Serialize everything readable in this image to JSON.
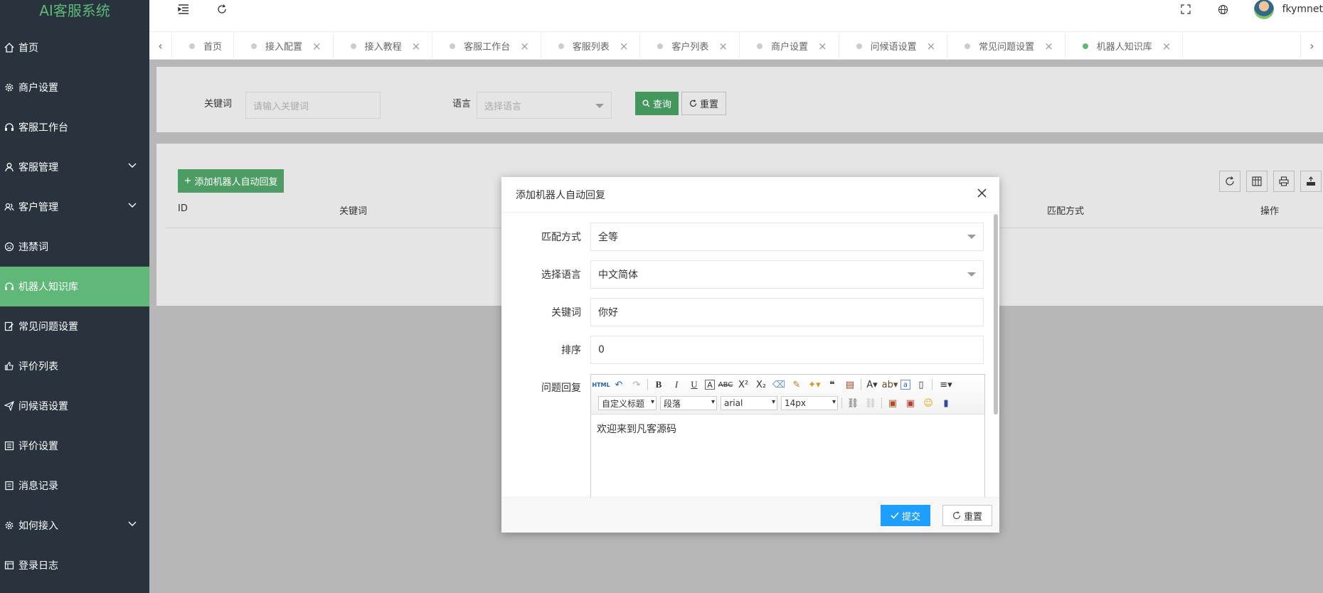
{
  "app": {
    "title": "AI客服系统"
  },
  "sidebar": {
    "items": [
      {
        "label": "首页",
        "icon": "home-icon"
      },
      {
        "label": "商户设置",
        "icon": "gear-icon"
      },
      {
        "label": "客服工作台",
        "icon": "headset-icon"
      },
      {
        "label": "客服管理",
        "icon": "user-icon",
        "expandable": true
      },
      {
        "label": "客户管理",
        "icon": "users-icon",
        "expandable": true
      },
      {
        "label": "违禁词",
        "icon": "face-icon"
      },
      {
        "label": "机器人知识库",
        "icon": "robot-icon",
        "active": true
      },
      {
        "label": "常见问题设置",
        "icon": "edit-icon"
      },
      {
        "label": "评价列表",
        "icon": "thumb-icon"
      },
      {
        "label": "问候语设置",
        "icon": "send-icon"
      },
      {
        "label": "评价设置",
        "icon": "list-icon"
      },
      {
        "label": "消息记录",
        "icon": "doc-icon"
      },
      {
        "label": "如何接入",
        "icon": "gear2-icon",
        "expandable": true
      },
      {
        "label": "登录日志",
        "icon": "log-icon"
      }
    ]
  },
  "header": {
    "username": "fkymnet"
  },
  "tabs": [
    {
      "label": "首页",
      "closable": false
    },
    {
      "label": "接入配置"
    },
    {
      "label": "接入教程"
    },
    {
      "label": "客服工作台"
    },
    {
      "label": "客服列表"
    },
    {
      "label": "客户列表"
    },
    {
      "label": "商户设置"
    },
    {
      "label": "问候语设置"
    },
    {
      "label": "常见问题设置"
    },
    {
      "label": "机器人知识库",
      "active": true
    }
  ],
  "search": {
    "keyword_label": "关键词",
    "keyword_placeholder": "请输入关键词",
    "language_label": "语言",
    "language_placeholder": "选择语言",
    "query_button": "查询",
    "reset_button": "重置"
  },
  "list": {
    "add_button": "添加机器人自动回复",
    "columns": [
      "ID",
      "关键词",
      "匹配方式",
      "操作"
    ]
  },
  "modal": {
    "title": "添加机器人自动回复",
    "fields": {
      "match_label": "匹配方式",
      "match_value": "全等",
      "language_label": "选择语言",
      "language_value": "中文简体",
      "keyword_label": "关键词",
      "keyword_value": "你好",
      "order_label": "排序",
      "order_value": "0",
      "reply_label": "问题回复"
    },
    "editor": {
      "heading_select": "自定义标题",
      "paragraph_select": "段落",
      "font_select": "arial",
      "size_select": "14px",
      "html_btn": "HTML",
      "content": "欢迎来到凡客源码"
    },
    "submit_button": "提交",
    "reset_button": "重置"
  },
  "colors": {
    "sidebar_bg": "#28333e",
    "accent_green": "#5fb878",
    "submit_blue": "#1e9fff"
  }
}
